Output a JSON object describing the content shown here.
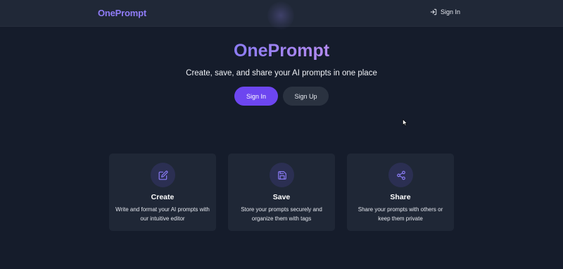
{
  "navbar": {
    "logo": "OnePrompt",
    "signin_label": "Sign In",
    "signin_icon": "log-in-icon"
  },
  "hero": {
    "title": "OnePrompt",
    "subtitle": "Create, save, and share your AI prompts in one place",
    "signin_label": "Sign In",
    "signup_label": "Sign Up"
  },
  "features": [
    {
      "icon": "edit-icon",
      "title": "Create",
      "description": "Write and format your AI prompts with our intuitive editor"
    },
    {
      "icon": "save-icon",
      "title": "Save",
      "description": "Store your prompts securely and organize them with tags"
    },
    {
      "icon": "share-icon",
      "title": "Share",
      "description": "Share your prompts with others or keep them private"
    }
  ],
  "colors": {
    "background": "#151c2b",
    "navbar": "#202837",
    "accent": "#6d46f0",
    "brand": "#8f7cf7",
    "card": "#1f2736",
    "icon_circle": "#2b2f52"
  }
}
